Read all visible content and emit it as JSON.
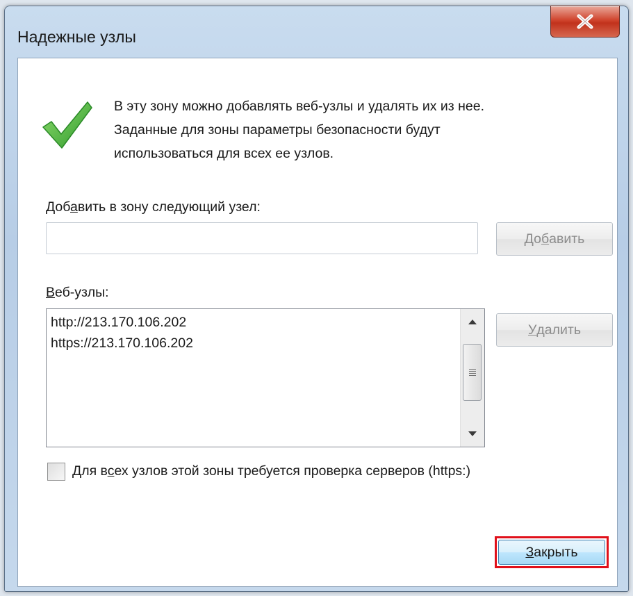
{
  "window": {
    "title": "Надежные узлы",
    "close_icon": "close-x-icon"
  },
  "info": {
    "icon": "checkmark-icon",
    "line1": "В эту зону можно добавлять веб-узлы и удалять их из нее.",
    "line2": "Заданные для зоны параметры безопасности будут",
    "line3": "использоваться для всех ее узлов."
  },
  "add": {
    "label_pre": "Доб",
    "label_acc": "а",
    "label_post": "вить в зону следующий узел:",
    "input_value": "",
    "button_pre": "До",
    "button_acc": "б",
    "button_post": "авить"
  },
  "sites": {
    "label_acc": "В",
    "label_post": "еб-узлы:",
    "items": [
      "http://213.170.106.202",
      "https://213.170.106.202"
    ],
    "remove_acc": "У",
    "remove_post": "далить"
  },
  "https_check": {
    "label_pre": "Для в",
    "label_acc": "с",
    "label_post": "ех узлов этой зоны требуется проверка серверов (https:)",
    "checked": false
  },
  "footer": {
    "close_acc": "З",
    "close_post": "акрыть"
  },
  "colors": {
    "accent_red": "#e0101a",
    "check_green": "#3cae3a"
  }
}
